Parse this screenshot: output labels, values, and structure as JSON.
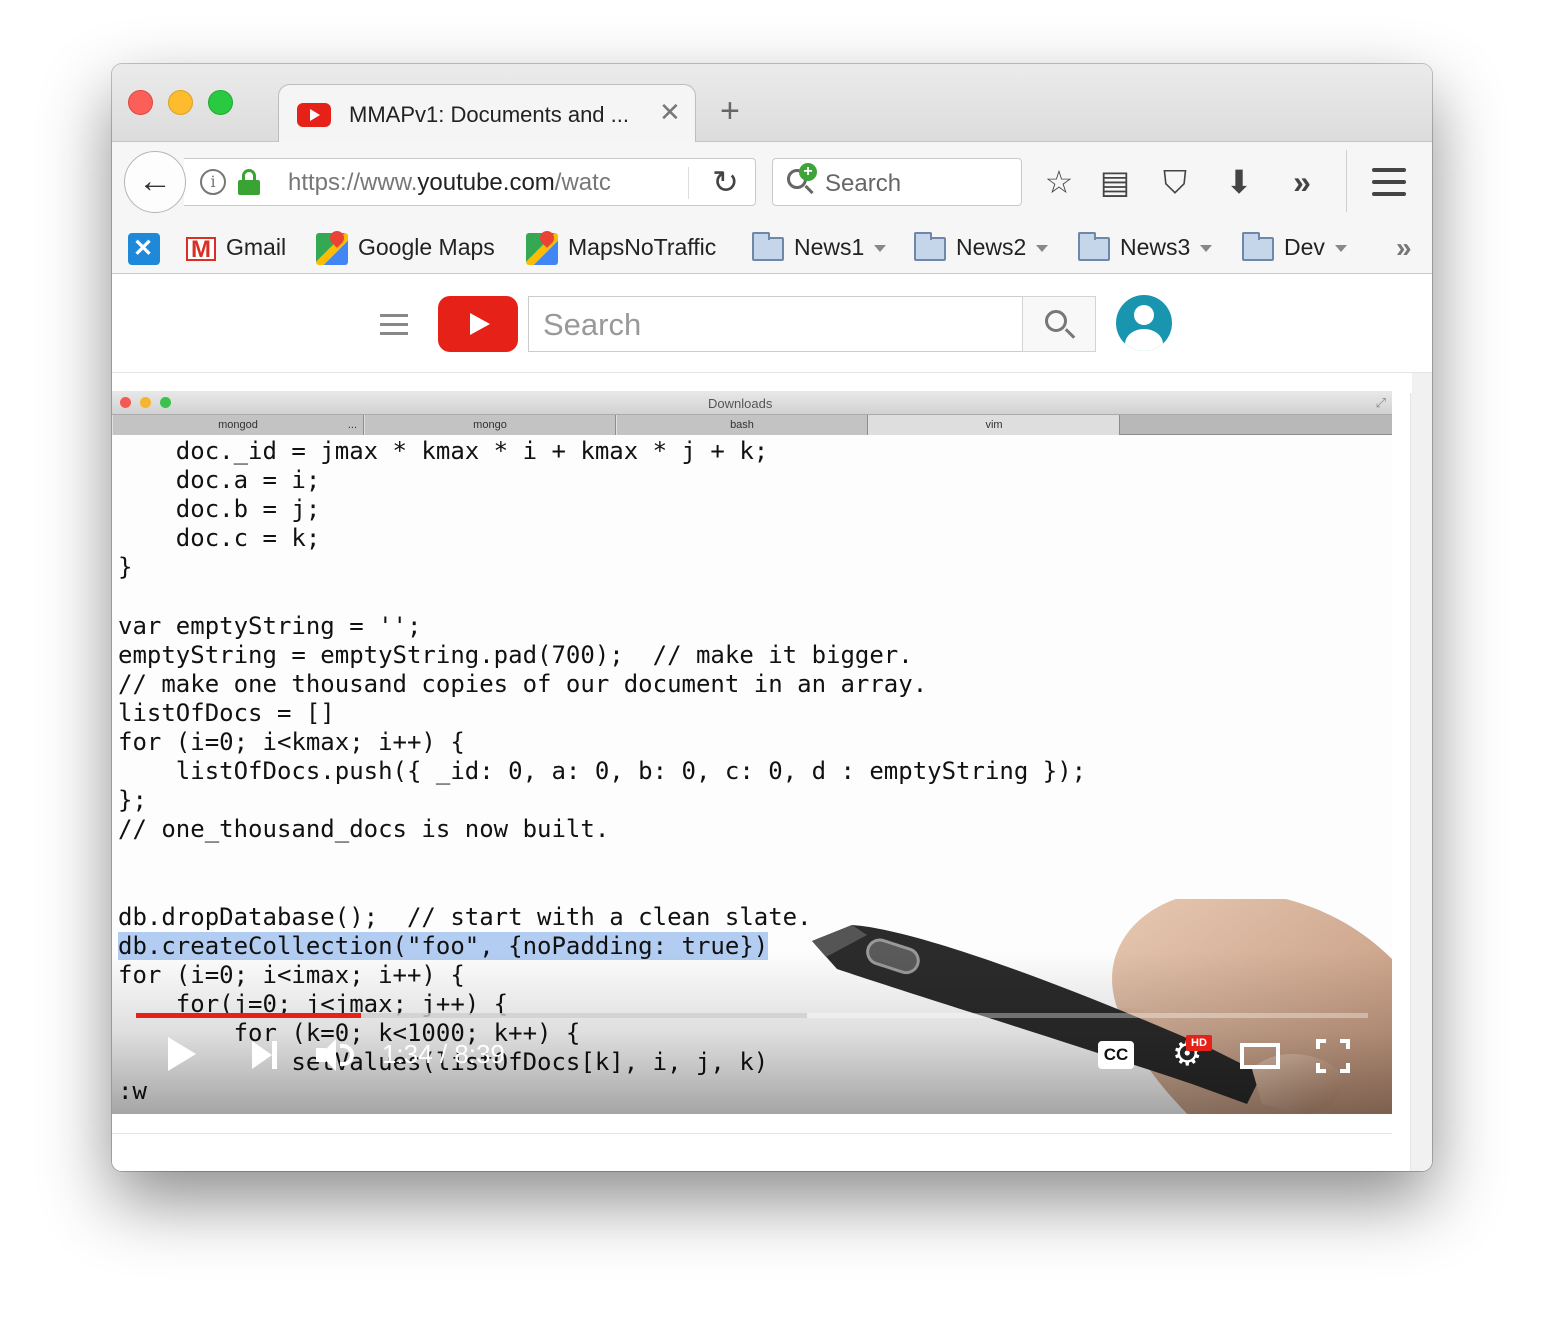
{
  "browser": {
    "tab": {
      "title": "MMAPv1: Documents and ...",
      "close": "✕"
    },
    "new_tab": "+",
    "url": {
      "prefix": "https://www.",
      "domain": "youtube.com",
      "suffix": "/watc"
    },
    "search_placeholder": "Search",
    "bookmarks": [
      {
        "label": "Gmail",
        "icon": "gmail-icon"
      },
      {
        "label": "Google Maps",
        "icon": "maps-icon"
      },
      {
        "label": "MapsNoTraffic",
        "icon": "maps-icon"
      },
      {
        "label": "News1",
        "icon": "folder-icon"
      },
      {
        "label": "News2",
        "icon": "folder-icon"
      },
      {
        "label": "News3",
        "icon": "folder-icon"
      },
      {
        "label": "Dev",
        "icon": "folder-icon"
      }
    ]
  },
  "youtube": {
    "search_placeholder": "Search"
  },
  "video": {
    "terminal_title": "Downloads",
    "terminal_tabs": [
      "mongod",
      "mongo",
      "bash",
      "vim"
    ],
    "terminal_tab_ellipsis": "...",
    "code_lines": [
      "    doc._id = jmax * kmax * i + kmax * j + k;",
      "    doc.a = i;",
      "    doc.b = j;",
      "    doc.c = k;",
      "}",
      "",
      "var emptyString = '';",
      "emptyString = emptyString.pad(700);  // make it bigger.",
      "// make one thousand copies of our document in an array.",
      "listOfDocs = []",
      "for (i=0; i<kmax; i++) {",
      "    listOfDocs.push({ _id: 0, a: 0, b: 0, c: 0, d : emptyString });",
      "};",
      "// one_thousand_docs is now built.",
      "",
      "",
      "db.dropDatabase();  // start with a clean slate."
    ],
    "highlighted_line": "db.createCollection(\"foo\", {noPadding: true})",
    "code_lines_after": [
      "for (i=0; i<imax; i++) {",
      "    for(j=0; j<jmax; j++) {",
      "        for (k=0; k<1000; k++) {",
      "            setValues(listOfDocs[k], i, j, k)",
      ":w"
    ],
    "time": "1:34 / 8:39",
    "progress_played": 0.183,
    "progress_buffered": 0.545,
    "cc_label": "CC",
    "hd_label": "HD",
    "colors": {
      "progress": "#e62117",
      "highlight": "#b3cdf2"
    }
  }
}
